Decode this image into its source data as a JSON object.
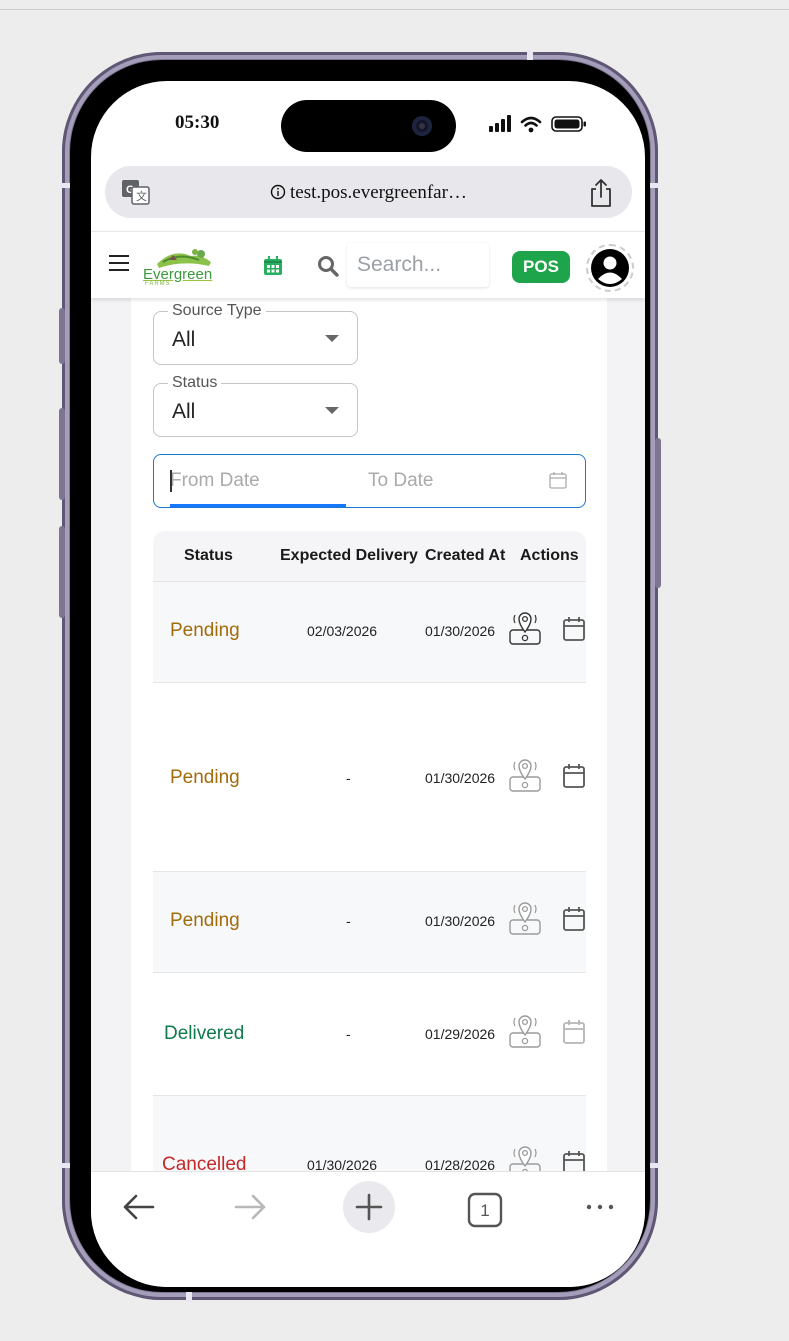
{
  "status_bar": {
    "time": "05:30"
  },
  "browser": {
    "url": "test.pos.evergreenfar…"
  },
  "header": {
    "logo_text": "Evergreen",
    "logo_sub": "FARMS",
    "search_placeholder": "Search...",
    "pos_label": "POS"
  },
  "filters": {
    "source_type": {
      "label": "Source Type",
      "value": "All"
    },
    "status": {
      "label": "Status",
      "value": "All"
    },
    "date": {
      "from_placeholder": "From Date",
      "to_placeholder": "To Date"
    }
  },
  "table": {
    "columns": [
      "Status",
      "Expected Delivery",
      "Created At",
      "Actions"
    ],
    "rows": [
      {
        "status": "Pending",
        "expected": "02/03/2026",
        "created": "01/30/2026"
      },
      {
        "status": "Pending",
        "expected": "-",
        "created": "01/30/2026"
      },
      {
        "status": "Pending",
        "expected": "-",
        "created": "01/30/2026"
      },
      {
        "status": "Delivered",
        "expected": "-",
        "created": "01/29/2026"
      },
      {
        "status": "Cancelled",
        "expected": "01/30/2026",
        "created": "01/28/2026"
      }
    ]
  },
  "bottom_bar": {
    "tab_count": "1"
  },
  "colors": {
    "accent_green": "#1ea44b",
    "focus_blue": "#1976d2",
    "pending": "#a26b0b",
    "delivered": "#107a4a",
    "cancelled": "#c62828"
  }
}
